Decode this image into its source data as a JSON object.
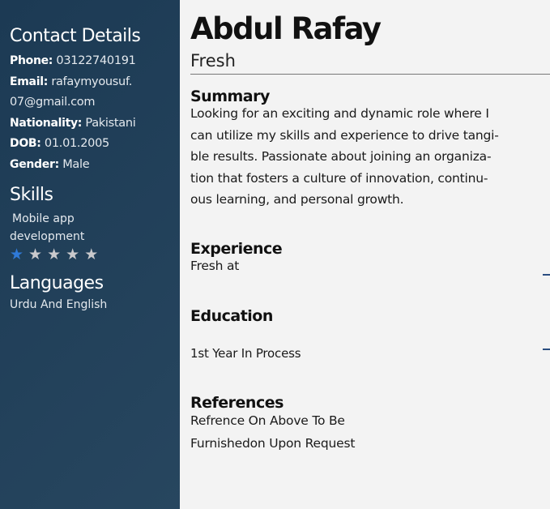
{
  "sidebar": {
    "contact_heading": "Contact Details",
    "phone_label": "Phone:",
    "phone": "03122740191",
    "email_label": "Email:",
    "email_1": "rafaymyousuf.",
    "email_2": "07@gmail.com",
    "nationality_label": "Nationality:",
    "nationality": "Pakistani",
    "dob_label": "DOB:",
    "dob": "01.01.2005",
    "gender_label": "Gender:",
    "gender": "Male",
    "skills_heading": "Skills",
    "skill_1": "Mobile app",
    "skill_2": "development",
    "skill_rating": 1,
    "skill_rating_max": 5,
    "languages_heading": "Languages",
    "languages": "Urdu And English"
  },
  "main": {
    "name": "Abdul Rafay",
    "title": "Fresh",
    "summary_heading": "Summary",
    "summary_lines": [
      "Looking for an exciting and dynamic role where I",
      "can utilize my skills and experience to drive tangi-",
      "ble results. Passionate about joining an organiza-",
      "tion that fosters a culture of innovation, continu-",
      "ous learning, and personal growth."
    ],
    "experience_heading": "Experience",
    "experience": "Fresh at",
    "education_heading": "Education",
    "education": "1st Year In Process",
    "references_heading": "References",
    "references_lines": [
      "Refrence On Above To Be",
      "Furnishedon Upon Request"
    ]
  }
}
